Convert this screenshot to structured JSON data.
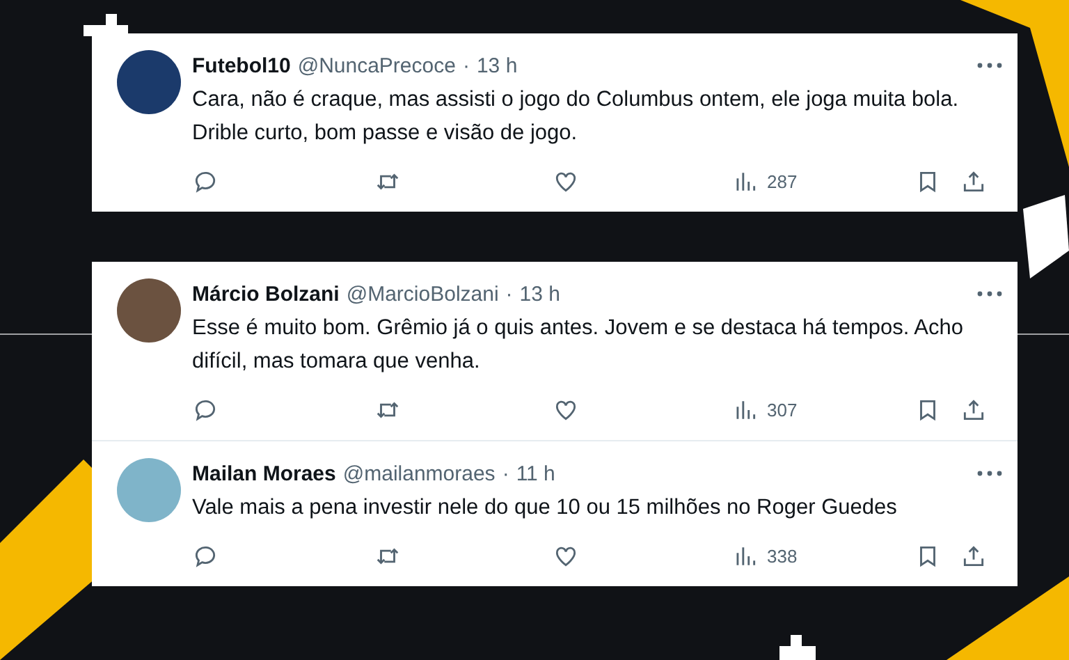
{
  "cards": [
    {
      "tweets": [
        {
          "name": "Futebol10",
          "handle": "@NuncaPrecoce",
          "separator": "·",
          "time": "13 h",
          "text": "Cara, não é craque, mas assisti o jogo do Columbus ontem, ele joga muita bola. Drible curto, bom passe e visão de jogo.",
          "views": "287"
        }
      ]
    },
    {
      "tweets": [
        {
          "name": "Márcio Bolzani",
          "handle": "@MarcioBolzani",
          "separator": "·",
          "time": "13 h",
          "text": "Esse é muito bom. Grêmio já o quis antes. Jovem e se destaca há tempos. Acho difícil, mas tomara que venha.",
          "views": "307"
        },
        {
          "name": "Mailan Moraes",
          "handle": "@mailanmoraes",
          "separator": "·",
          "time": "11 h",
          "text": "Vale mais a pena investir nele do que 10 ou 15 milhões no Roger Guedes",
          "views": "338"
        }
      ]
    }
  ]
}
